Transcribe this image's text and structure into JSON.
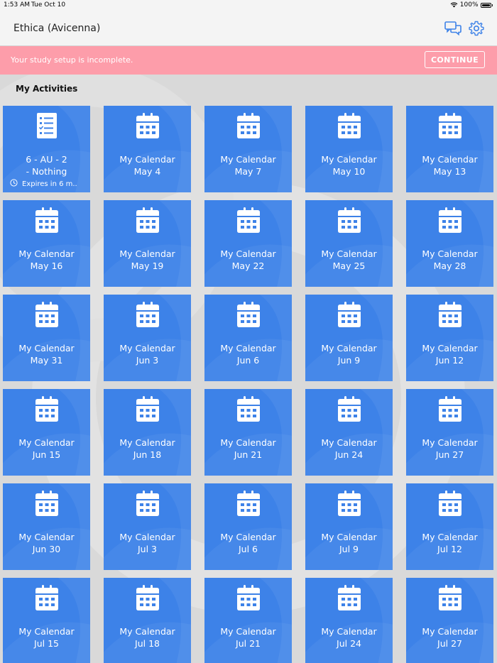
{
  "status_bar": {
    "time": "1:53 AM",
    "date": "Tue Oct 10",
    "battery": "100%"
  },
  "header": {
    "title": "Ethica (Avicenna)",
    "icons": [
      "chat-icon",
      "gear-icon"
    ]
  },
  "banner": {
    "message": "Your study setup is incomplete.",
    "button_label": "CONTINUE"
  },
  "section_title": "My Activities",
  "colors": {
    "tile": "#3d82e8",
    "banner": "#fd9daa",
    "header": "#f4f4f4",
    "background": "#d9d9d9"
  },
  "activities": [
    {
      "type": "survey",
      "line1": "6 - AU - 2",
      "line2": "- Nothing",
      "expires": "Expires in 6 m.."
    },
    {
      "type": "calendar",
      "line1": "My Calendar",
      "line2": "May 4"
    },
    {
      "type": "calendar",
      "line1": "My Calendar",
      "line2": "May 7"
    },
    {
      "type": "calendar",
      "line1": "My Calendar",
      "line2": "May 10"
    },
    {
      "type": "calendar",
      "line1": "My Calendar",
      "line2": "May 13"
    },
    {
      "type": "calendar",
      "line1": "My Calendar",
      "line2": "May 16"
    },
    {
      "type": "calendar",
      "line1": "My Calendar",
      "line2": "May 19"
    },
    {
      "type": "calendar",
      "line1": "My Calendar",
      "line2": "May 22"
    },
    {
      "type": "calendar",
      "line1": "My Calendar",
      "line2": "May 25"
    },
    {
      "type": "calendar",
      "line1": "My Calendar",
      "line2": "May 28"
    },
    {
      "type": "calendar",
      "line1": "My Calendar",
      "line2": "May 31"
    },
    {
      "type": "calendar",
      "line1": "My Calendar",
      "line2": "Jun 3"
    },
    {
      "type": "calendar",
      "line1": "My Calendar",
      "line2": "Jun 6"
    },
    {
      "type": "calendar",
      "line1": "My Calendar",
      "line2": "Jun 9"
    },
    {
      "type": "calendar",
      "line1": "My Calendar",
      "line2": "Jun 12"
    },
    {
      "type": "calendar",
      "line1": "My Calendar",
      "line2": "Jun 15"
    },
    {
      "type": "calendar",
      "line1": "My Calendar",
      "line2": "Jun 18"
    },
    {
      "type": "calendar",
      "line1": "My Calendar",
      "line2": "Jun 21"
    },
    {
      "type": "calendar",
      "line1": "My Calendar",
      "line2": "Jun 24"
    },
    {
      "type": "calendar",
      "line1": "My Calendar",
      "line2": "Jun 27"
    },
    {
      "type": "calendar",
      "line1": "My Calendar",
      "line2": "Jun 30"
    },
    {
      "type": "calendar",
      "line1": "My Calendar",
      "line2": "Jul 3"
    },
    {
      "type": "calendar",
      "line1": "My Calendar",
      "line2": "Jul 6"
    },
    {
      "type": "calendar",
      "line1": "My Calendar",
      "line2": "Jul 9"
    },
    {
      "type": "calendar",
      "line1": "My Calendar",
      "line2": "Jul 12"
    },
    {
      "type": "calendar",
      "line1": "My Calendar",
      "line2": "Jul 15"
    },
    {
      "type": "calendar",
      "line1": "My Calendar",
      "line2": "Jul 18"
    },
    {
      "type": "calendar",
      "line1": "My Calendar",
      "line2": "Jul 21"
    },
    {
      "type": "calendar",
      "line1": "My Calendar",
      "line2": "Jul 24"
    },
    {
      "type": "calendar",
      "line1": "My Calendar",
      "line2": "Jul 27"
    }
  ]
}
